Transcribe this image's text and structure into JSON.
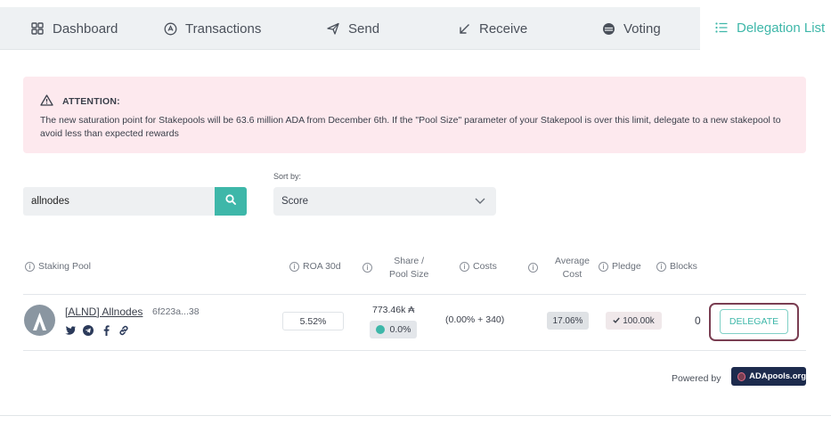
{
  "tabs": [
    {
      "label": "Dashboard",
      "icon": "dashboard-icon",
      "active": false
    },
    {
      "label": "Transactions",
      "icon": "transactions-icon",
      "active": false
    },
    {
      "label": "Send",
      "icon": "send-icon",
      "active": false
    },
    {
      "label": "Receive",
      "icon": "receive-icon",
      "active": false
    },
    {
      "label": "Voting",
      "icon": "voting-icon",
      "active": false
    },
    {
      "label": "Delegation List",
      "icon": "list-icon",
      "active": true
    }
  ],
  "alert": {
    "title": "ATTENTION:",
    "body": "The new saturation point for Stakepools will be 63.6 million ADA from December 6th. If the \"Pool Size\" parameter of your Stakepool is over this limit, delegate to a new stakepool to avoid less than expected rewards"
  },
  "search": {
    "value": "allnodes"
  },
  "sort": {
    "label": "Sort by:",
    "value": "Score"
  },
  "columns": {
    "pool": "Staking Pool",
    "roa": "ROA 30d",
    "share_line1": "Share /",
    "share_line2": "Pool Size",
    "costs": "Costs",
    "avg_line1": "Average",
    "avg_line2": "Cost",
    "pledge": "Pledge",
    "blocks": "Blocks"
  },
  "row": {
    "name": "[ALND] Allnodes",
    "pool_id": "6f223a...38",
    "roa": "5.52%",
    "share": "773.46k ₳",
    "pool_size": "0.0%",
    "costs": "(0.00% + 340)",
    "avg_cost": "17.06%",
    "pledge": "100.00k",
    "blocks": "0",
    "action": "DELEGATE",
    "socials": [
      "twitter-icon",
      "telegram-icon",
      "facebook-icon",
      "link-icon"
    ]
  },
  "footer": {
    "powered_by": "Powered by",
    "logo_text": "ADApools.org"
  },
  "colors": {
    "accent": "#3eb7a9",
    "alert_bg": "#fde9ee",
    "highlight_frame": "#7a3e52",
    "logo_bg": "#1d2b4d"
  }
}
